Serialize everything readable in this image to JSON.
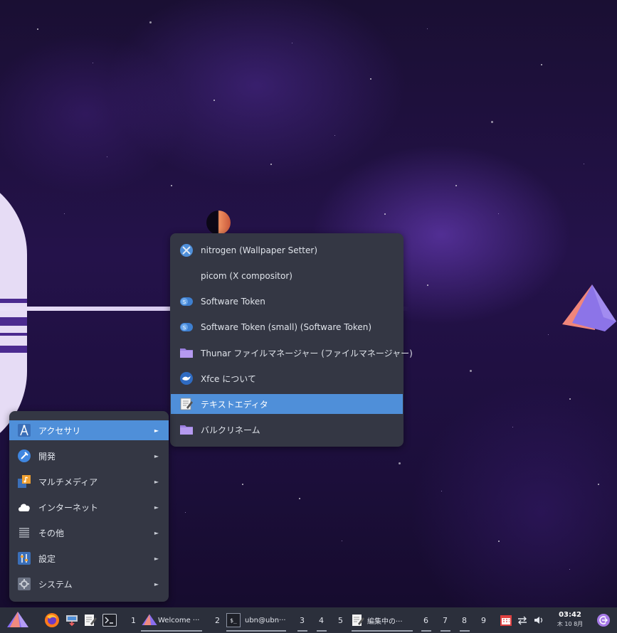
{
  "main_menu": {
    "items": [
      {
        "label": "アクセサリ",
        "icon": "accessories-icon",
        "active": true
      },
      {
        "label": "開発",
        "icon": "development-icon"
      },
      {
        "label": "マルチメディア",
        "icon": "multimedia-icon"
      },
      {
        "label": "インターネット",
        "icon": "internet-cloud-icon"
      },
      {
        "label": "その他",
        "icon": "other-icon"
      },
      {
        "label": "設定",
        "icon": "settings-icon"
      },
      {
        "label": "システム",
        "icon": "system-icon"
      }
    ],
    "arrow": "►"
  },
  "sub_menu": {
    "items": [
      {
        "label": "nitrogen (Wallpaper Setter)",
        "icon": "nitrogen-icon"
      },
      {
        "label": "picom (X compositor)",
        "icon": ""
      },
      {
        "label": "Software Token",
        "icon": "software-token-icon"
      },
      {
        "label": "Software Token (small) (Software Token)",
        "icon": "software-token-icon"
      },
      {
        "label": "Thunar ファイルマネージャー (ファイルマネージャー)",
        "icon": "folder-icon"
      },
      {
        "label": "Xfce について",
        "icon": "xfce-icon"
      },
      {
        "label": "テキストエディタ",
        "icon": "text-editor-icon",
        "active": true
      },
      {
        "label": "バルクリネーム",
        "icon": "folder-icon"
      }
    ]
  },
  "taskbar": {
    "workspaces": [
      "1",
      "2",
      "3",
      "4",
      "5",
      "6",
      "7",
      "8",
      "9"
    ],
    "tasks": {
      "welcome": "Welcome ···",
      "terminal": "ubn@ubn···",
      "editor": "編集中の···"
    },
    "terminal_glyph": "$_",
    "clock_time": "03:42",
    "clock_date": "木 10 8月"
  },
  "colors": {
    "menu_bg": "#343744",
    "highlight": "#4f8fd9",
    "taskbar_bg": "#2b2f3b"
  }
}
